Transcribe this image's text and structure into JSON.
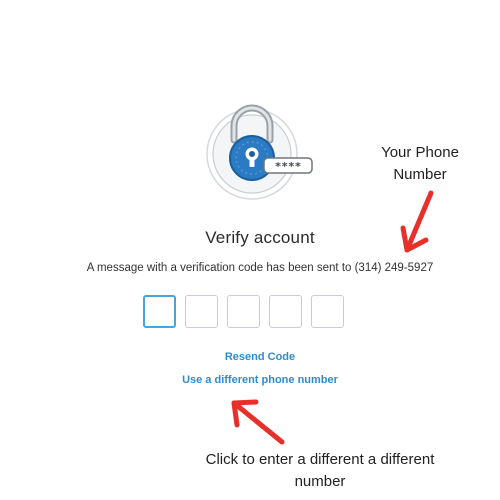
{
  "verify": {
    "lock_label": "****",
    "title": "Verify account",
    "message": "A message with a verification code has been sent to (314) 249-5927",
    "code_box_count": 5,
    "resend_label": "Resend Code",
    "different_number_label": "Use a different phone number"
  },
  "annotations": {
    "phone_line1": "Your Phone",
    "phone_line2": "Number",
    "click_line1": "Click to enter a different a different",
    "click_line2": "number"
  },
  "colors": {
    "accent": "#2e8bd0",
    "arrow": "#e8302a",
    "lock_blue": "#2a7bc4",
    "focus_border": "#4aa3e0"
  }
}
